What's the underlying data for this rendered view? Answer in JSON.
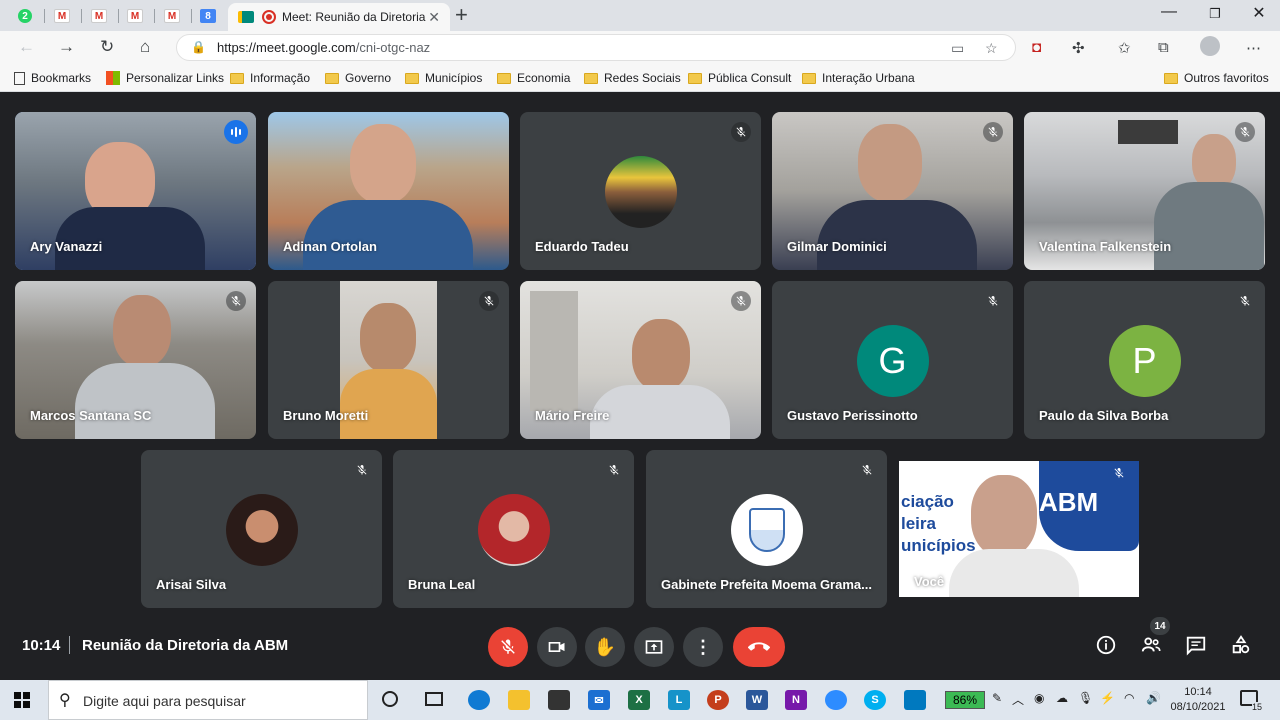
{
  "browser": {
    "tab_title": "Meet: Reunião da Diretoria",
    "url_host": "https://meet.google.com",
    "url_path": "/cni-otgc-naz",
    "mini_tabs": [
      "2",
      "M",
      "M",
      "M",
      "M",
      "8"
    ],
    "bookmarks": [
      "Bookmarks",
      "Personalizar Links",
      "Informação",
      "Governo",
      "Municípios",
      "Economia",
      "Redes Sociais",
      "Pública Consult",
      "Interação Urbana"
    ],
    "other_bookmarks": "Outros favoritos"
  },
  "participants": [
    {
      "name": "Ary Vanazzi",
      "speaking": true
    },
    {
      "name": "Adinan Ortolan"
    },
    {
      "name": "Eduardo Tadeu"
    },
    {
      "name": "Gilmar Dominici"
    },
    {
      "name": "Valentina Falkenstein"
    },
    {
      "name": "Marcos Santana SC"
    },
    {
      "name": "Bruno Moretti"
    },
    {
      "name": "Mário Freire"
    },
    {
      "name": "Gustavo Perissinotto",
      "initial": "G",
      "color": "#00897b"
    },
    {
      "name": "Paulo da Silva Borba",
      "initial": "P",
      "color": "#7cb342"
    },
    {
      "name": "Arisai Silva"
    },
    {
      "name": "Bruna Leal"
    },
    {
      "name": "Gabinete Prefeita Moema Grama..."
    },
    {
      "name": "Você"
    }
  ],
  "meeting": {
    "time": "10:14",
    "title": "Reunião da Diretoria da ABM",
    "participant_count": "14"
  },
  "taskbar": {
    "search_placeholder": "Digite aqui para pesquisar",
    "battery": "86%",
    "time": "10:14",
    "date": "08/10/2021",
    "notifications": "15"
  },
  "colors": {
    "meet_bg": "#202124",
    "tile_bg": "#3c4043",
    "mic_off_red": "#ea4335",
    "speaking_blue": "#1a73e8"
  }
}
